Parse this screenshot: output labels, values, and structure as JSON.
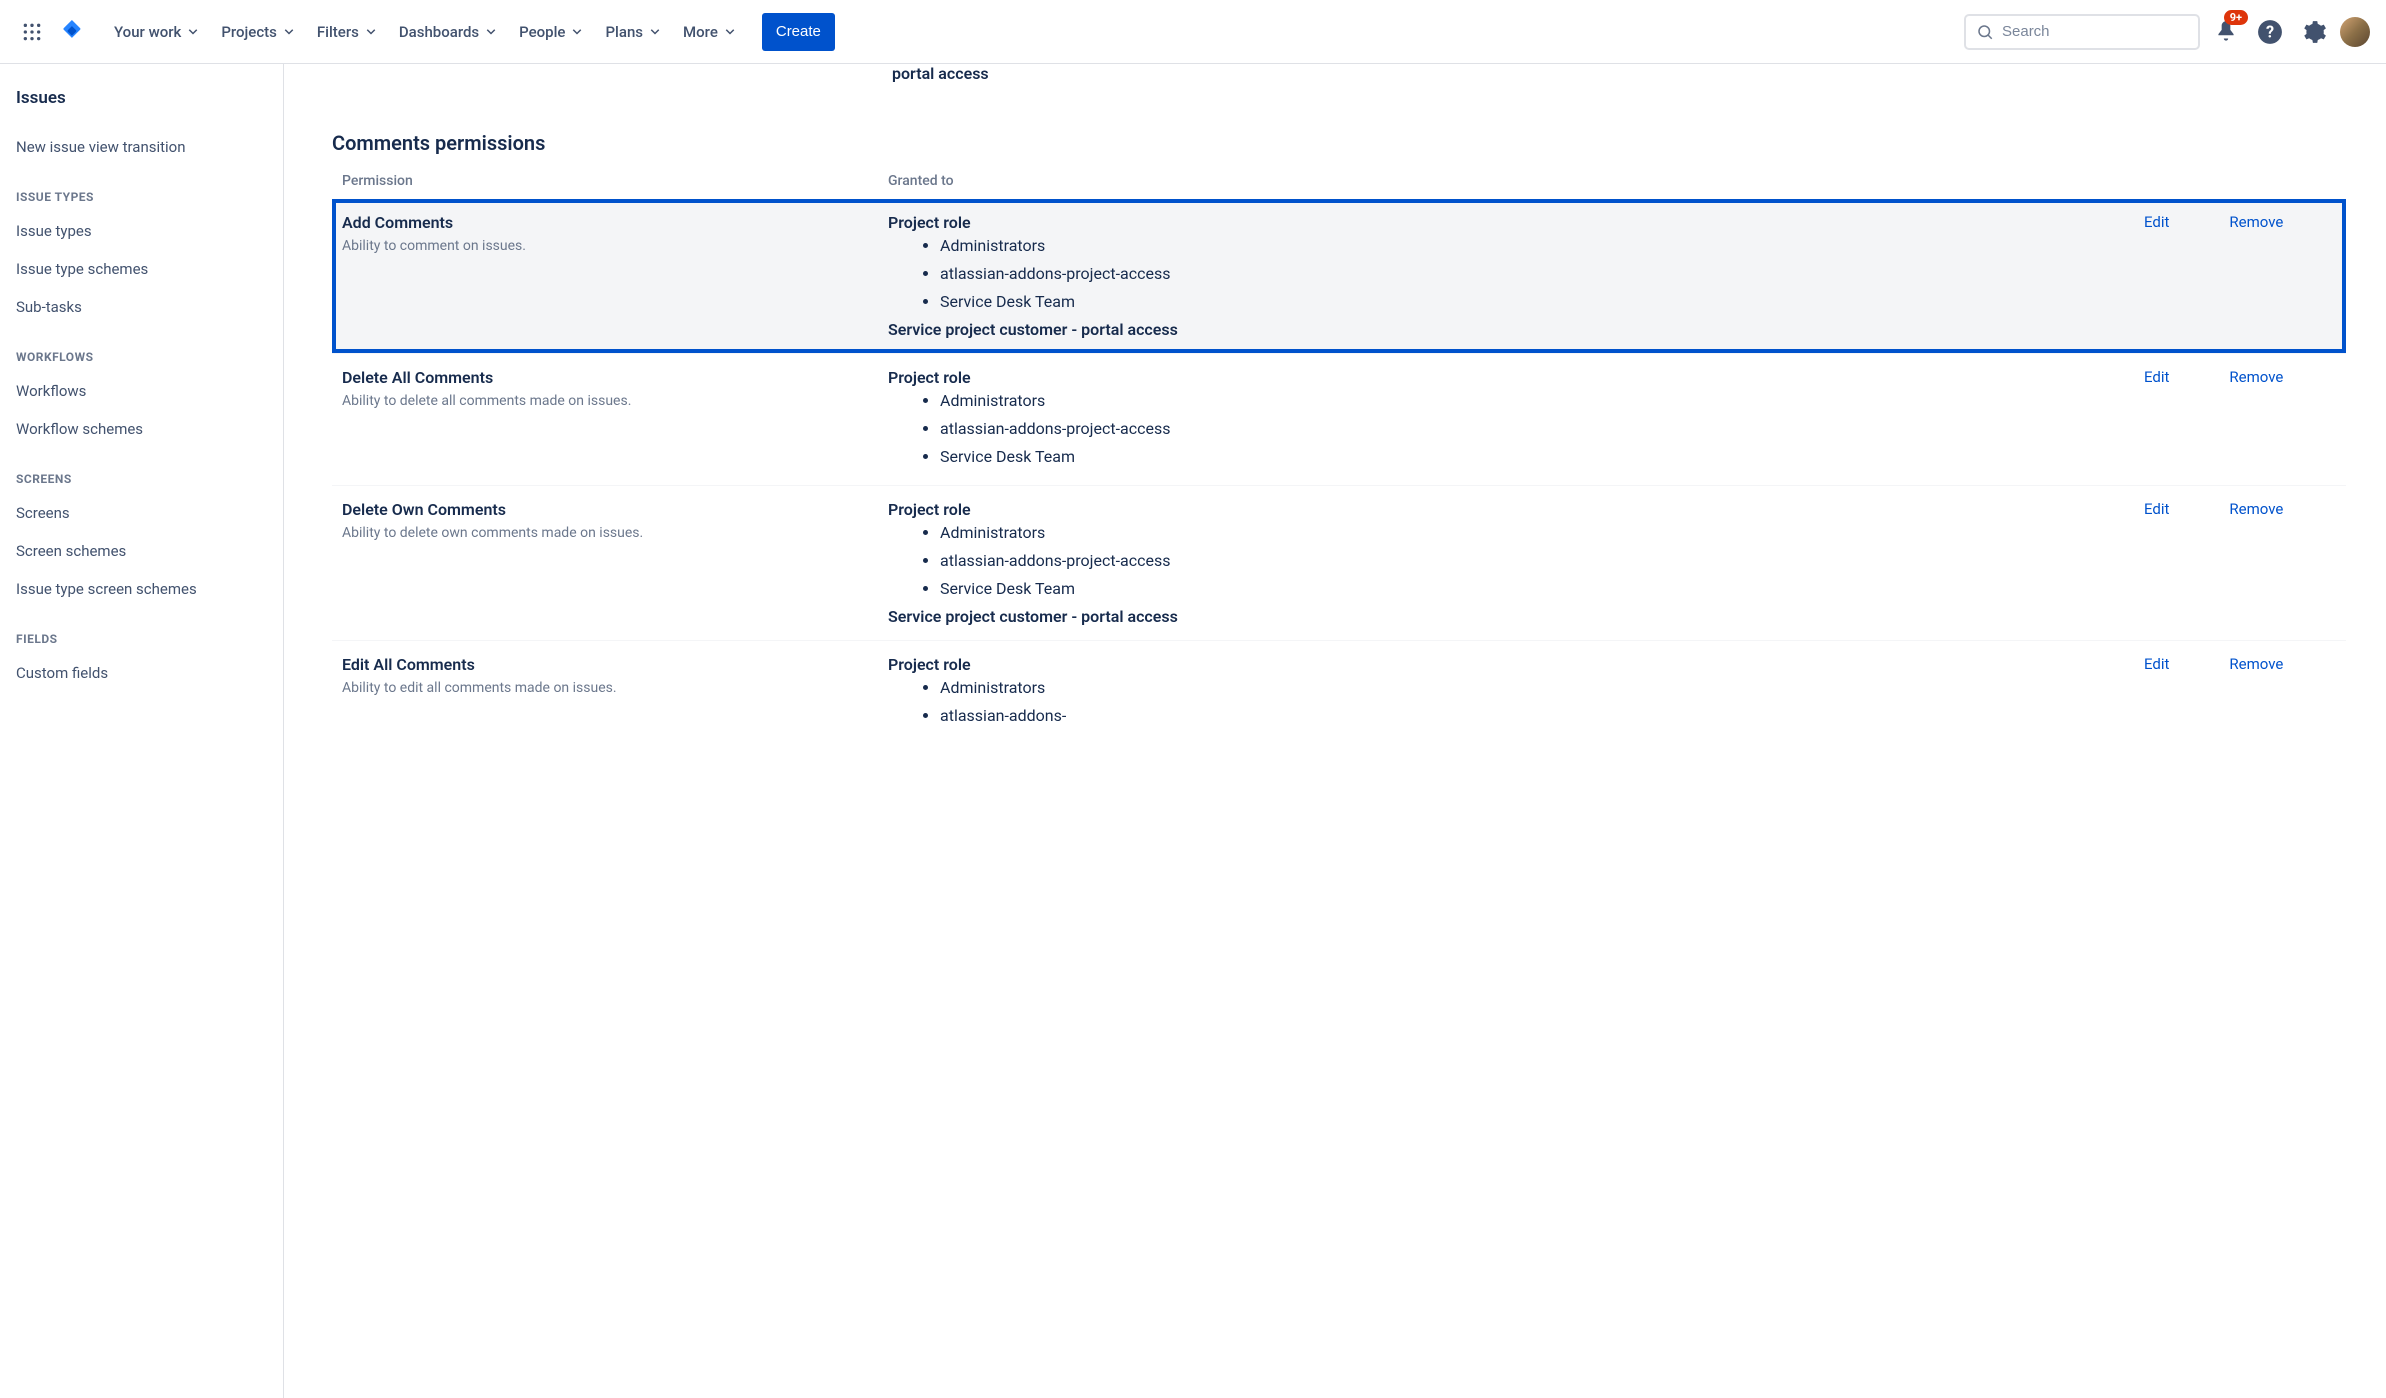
{
  "header": {
    "nav": {
      "your_work": "Your work",
      "projects": "Projects",
      "filters": "Filters",
      "dashboards": "Dashboards",
      "people": "People",
      "plans": "Plans",
      "more": "More"
    },
    "create_label": "Create",
    "search_placeholder": "Search",
    "notif_badge": "9+"
  },
  "sidebar": {
    "title": "Issues",
    "link_transition": "New issue view transition",
    "heading_issue_types": "ISSUE TYPES",
    "link_issue_types": "Issue types",
    "link_issue_type_schemes": "Issue type schemes",
    "link_subtasks": "Sub-tasks",
    "heading_workflows": "WORKFLOWS",
    "link_workflows": "Workflows",
    "link_workflow_schemes": "Workflow schemes",
    "heading_screens": "SCREENS",
    "link_screens": "Screens",
    "link_screen_schemes": "Screen schemes",
    "link_issue_type_screen_schemes": "Issue type screen schemes",
    "heading_fields": "FIELDS",
    "link_custom_fields": "Custom fields"
  },
  "main": {
    "truncated_top": "portal access",
    "section_title": "Comments permissions",
    "col_permission": "Permission",
    "col_granted_to": "Granted to",
    "edit_label": "Edit",
    "remove_label": "Remove",
    "role_label": "Project role",
    "service_portal": "Service project customer - portal access",
    "rows": [
      {
        "name": "Add Comments",
        "desc": "Ability to comment on issues.",
        "roles": [
          "Administrators",
          "atlassian-addons-project-access",
          "Service Desk Team"
        ],
        "has_portal": true,
        "highlighted": true
      },
      {
        "name": "Delete All Comments",
        "desc": "Ability to delete all comments made on issues.",
        "roles": [
          "Administrators",
          "atlassian-addons-project-access",
          "Service Desk Team"
        ],
        "has_portal": false,
        "highlighted": false
      },
      {
        "name": "Delete Own Comments",
        "desc": "Ability to delete own comments made on issues.",
        "roles": [
          "Administrators",
          "atlassian-addons-project-access",
          "Service Desk Team"
        ],
        "has_portal": true,
        "highlighted": false
      },
      {
        "name": "Edit All Comments",
        "desc": "Ability to edit all comments made on issues.",
        "roles": [
          "Administrators",
          "atlassian-addons-"
        ],
        "has_portal": false,
        "highlighted": false
      }
    ]
  }
}
